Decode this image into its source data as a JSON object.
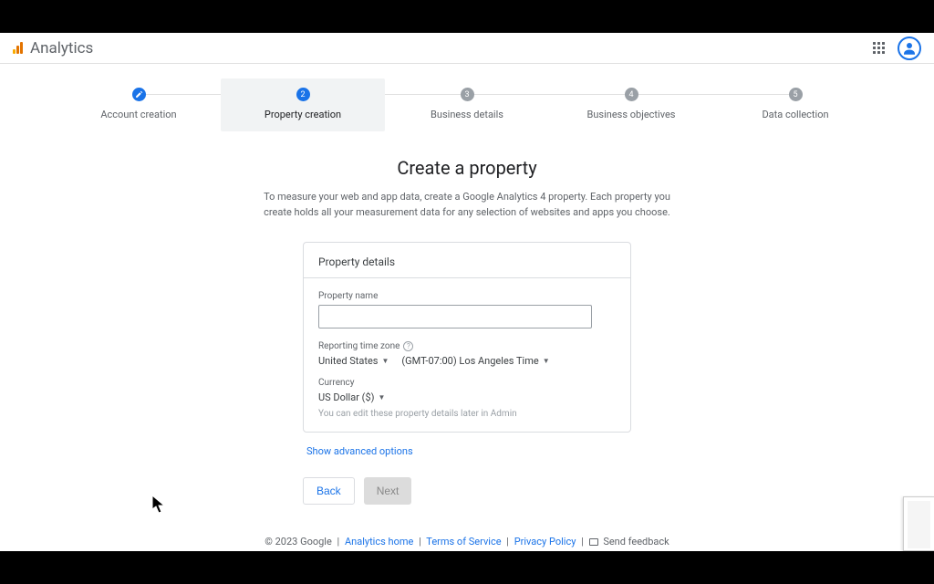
{
  "brand": "Analytics",
  "stepper": {
    "steps": [
      {
        "label": "Account creation",
        "state": "done",
        "num": ""
      },
      {
        "label": "Property creation",
        "state": "active",
        "num": "2"
      },
      {
        "label": "Business details",
        "state": "pending",
        "num": "3"
      },
      {
        "label": "Business objectives",
        "state": "pending",
        "num": "4"
      },
      {
        "label": "Data collection",
        "state": "pending",
        "num": "5"
      }
    ]
  },
  "page": {
    "title": "Create a property",
    "subtitle": "To measure your web and app data, create a Google Analytics 4 property. Each property you create holds all your measurement data for any selection of websites and apps you choose."
  },
  "card": {
    "header": "Property details",
    "property_name_label": "Property name",
    "property_name_value": "",
    "timezone_label": "Reporting time zone",
    "country": "United States",
    "timezone": "(GMT-07:00) Los Angeles Time",
    "currency_label": "Currency",
    "currency": "US Dollar ($)",
    "hint": "You can edit these property details later in Admin"
  },
  "advanced": "Show advanced options",
  "buttons": {
    "back": "Back",
    "next": "Next"
  },
  "footer": {
    "copyright": "© 2023 Google",
    "home": "Analytics home",
    "terms": "Terms of Service",
    "privacy": "Privacy Policy",
    "feedback": "Send feedback"
  }
}
